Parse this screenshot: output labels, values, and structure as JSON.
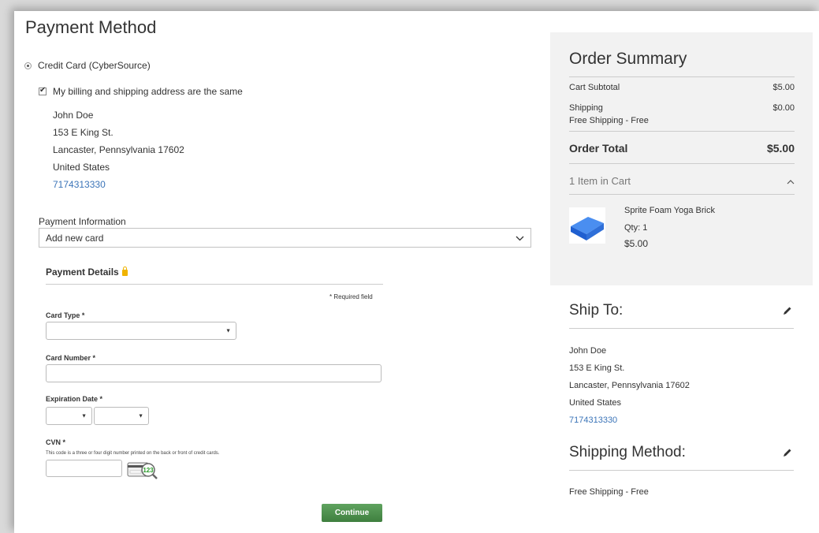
{
  "payment": {
    "title": "Payment Method",
    "method_label": "Credit Card (CyberSource)",
    "same_address_label": "My billing and shipping address are the same",
    "address": {
      "name": "John Doe",
      "street": "153 E King St.",
      "city_line": "Lancaster, Pennsylvania 17602",
      "country": "United States",
      "phone": "7174313330"
    },
    "info_label": "Payment Information",
    "info_selected": "Add new card"
  },
  "details": {
    "title": "Payment Details",
    "required_note": "* Required field",
    "card_type_label": "Card Type *",
    "card_number_label": "Card Number *",
    "expiration_label": "Expiration Date *",
    "cvn_label": "CVN *",
    "cvn_hint": "This code is a three or four digit number printed on the back or front of credit cards.",
    "cvn_icon_text": "123",
    "continue_label": "Continue"
  },
  "summary": {
    "title": "Order Summary",
    "subtotal_label": "Cart Subtotal",
    "subtotal_value": "$5.00",
    "shipping_label": "Shipping",
    "shipping_value": "$0.00",
    "shipping_sub": "Free Shipping - Free",
    "total_label": "Order Total",
    "total_value": "$5.00",
    "items_label": "1 Item in Cart",
    "product": {
      "name": "Sprite Foam Yoga Brick",
      "qty": "Qty: 1",
      "price": "$5.00"
    }
  },
  "ship_to": {
    "title": "Ship To:",
    "name": "John Doe",
    "street": "153 E King St.",
    "city_line": "Lancaster, Pennsylvania 17602",
    "country": "United States",
    "phone": "7174313330"
  },
  "shipping_method": {
    "title": "Shipping Method:",
    "value": "Free Shipping - Free"
  },
  "colors": {
    "link": "#3b74b8",
    "continue_button": "#4e944e",
    "summary_bg": "#f2f2f2",
    "product": "#2f6fd8"
  }
}
